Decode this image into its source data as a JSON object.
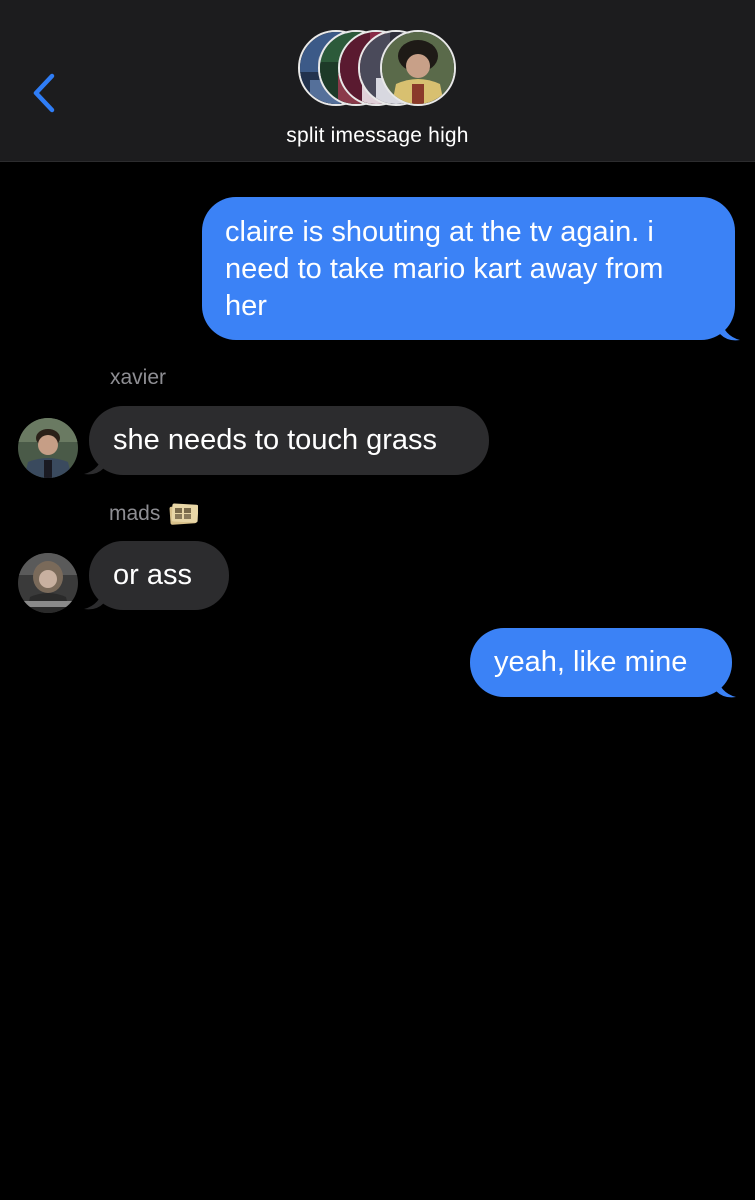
{
  "header": {
    "back_icon": "chevron-left-icon",
    "group_name": "split imessage high",
    "accent_color": "#2f7df6",
    "participants": [
      {
        "avatar": "participant-photo",
        "tone": "#3c5a88"
      },
      {
        "avatar": "participant-photo",
        "tone": "#2c5a3a"
      },
      {
        "avatar": "participant-photo",
        "tone": "#8a2a46"
      },
      {
        "avatar": "participant-photo",
        "tone": "#4a4a5a"
      },
      {
        "avatar": "participant-photo",
        "tone": "#6a5a3a"
      }
    ]
  },
  "messages": [
    {
      "direction": "sent",
      "lines": [
        "claire is shouting at the tv again. i",
        "need to take mario kart away from",
        "her"
      ]
    },
    {
      "direction": "received",
      "sender": "xavier",
      "avatar": "xavier-avatar",
      "lines": [
        "she needs to touch grass"
      ]
    },
    {
      "direction": "received",
      "sender": "mads",
      "sender_emoji": "film-frames-icon",
      "avatar": "mads-avatar",
      "lines": [
        "or ass"
      ]
    },
    {
      "direction": "sent",
      "lines": [
        "yeah, like mine"
      ]
    }
  ],
  "colors": {
    "sent_bubble": "#3b82f6",
    "received_bubble": "#2c2c2e",
    "header_bg": "#1c1c1e",
    "background": "#000000",
    "sender_name": "#8e8e93"
  }
}
